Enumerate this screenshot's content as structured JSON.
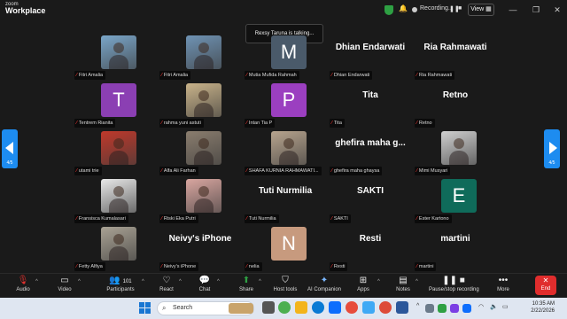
{
  "app": {
    "logo_top": "zoom",
    "logo_bottom": "Workplace"
  },
  "recording": {
    "label": "Recording...",
    "pause_icon": "pause-icon",
    "stop_icon": "stop-icon"
  },
  "view_button": "View",
  "talking_banner": "Rexsy Taruna is talking...",
  "pagination": {
    "left": "4/5",
    "right": "4/5"
  },
  "participants": [
    {
      "name": "Fitri Amalia",
      "display": "photo",
      "color": "#7aa6c9"
    },
    {
      "name": "Fitri Amalia",
      "display": "photo",
      "color": "#6f93b4"
    },
    {
      "name": "Mutia Mufida Rahmah",
      "display": "letter",
      "letter": "M",
      "color": "#4a5a6a"
    },
    {
      "name": "Dhian Endarwati",
      "display": "name",
      "big": "Dhian Endarwati"
    },
    {
      "name": "Ria Rahmawati",
      "display": "name",
      "big": "Ria Rahmawati"
    },
    {
      "name": "Tentrem Rianita",
      "display": "letter",
      "letter": "T",
      "color": "#8b3fb3"
    },
    {
      "name": "rahma yuni astuti",
      "display": "photo",
      "color": "#c9b38a"
    },
    {
      "name": "Intan Tia P",
      "display": "letter",
      "letter": "P",
      "color": "#9b3fc0"
    },
    {
      "name": "Tita",
      "display": "name",
      "big": "Tita"
    },
    {
      "name": "Retno",
      "display": "name",
      "big": "Retno"
    },
    {
      "name": "utami trie",
      "display": "photo",
      "color": "#c0392b"
    },
    {
      "name": "Alfa Ali Farhan",
      "display": "photo",
      "color": "#8a7d6e"
    },
    {
      "name": "SHAFA KURNIA RAHMAWATI...",
      "display": "photo",
      "color": "#b7a48e"
    },
    {
      "name": "ghefira maha ghaysa",
      "display": "name",
      "big": "ghefira maha g..."
    },
    {
      "name": "Mimi Musyari",
      "display": "photo",
      "color": "#cfcfcf"
    },
    {
      "name": "Fransisca Kumalasari",
      "display": "photo",
      "color": "#e8e8e8"
    },
    {
      "name": "Riski Eka Putri",
      "display": "photo",
      "color": "#d9a6a0"
    },
    {
      "name": "Tuti Nurmilia",
      "display": "name",
      "big": "Tuti Nurmilia"
    },
    {
      "name": "SAKTI",
      "display": "name",
      "big": "SAKTI"
    },
    {
      "name": "Ester Kartono",
      "display": "letter",
      "letter": "E",
      "color": "#0f6b5a"
    },
    {
      "name": "Fetty Alfiya",
      "display": "photo",
      "color": "#a9a294"
    },
    {
      "name": "Neivy's iPhone",
      "display": "name",
      "big": "Neivy's iPhone"
    },
    {
      "name": "nelia",
      "display": "letter",
      "letter": "N",
      "color": "#c79a7e"
    },
    {
      "name": "Resti",
      "display": "name",
      "big": "Resti"
    },
    {
      "name": "martini",
      "display": "name",
      "big": "martini"
    }
  ],
  "toolbar": {
    "audio": "Audio",
    "video": "Video",
    "participants": "Participants",
    "participants_count": "101",
    "react": "React",
    "chat": "Chat",
    "share": "Share",
    "host_tools": "Host tools",
    "ai_companion": "AI Companion",
    "apps": "Apps",
    "notes": "Notes",
    "pause_recording": "Pause/stop recording",
    "more": "More",
    "end": "End"
  },
  "taskbar": {
    "search_placeholder": "Search",
    "time": "10:35 AM",
    "date": "2/22/2026"
  },
  "colors": {
    "accent": "#1d8cf0",
    "end": "#e02d2d",
    "share": "#2ea043",
    "mic_muted": "#e0312e"
  }
}
